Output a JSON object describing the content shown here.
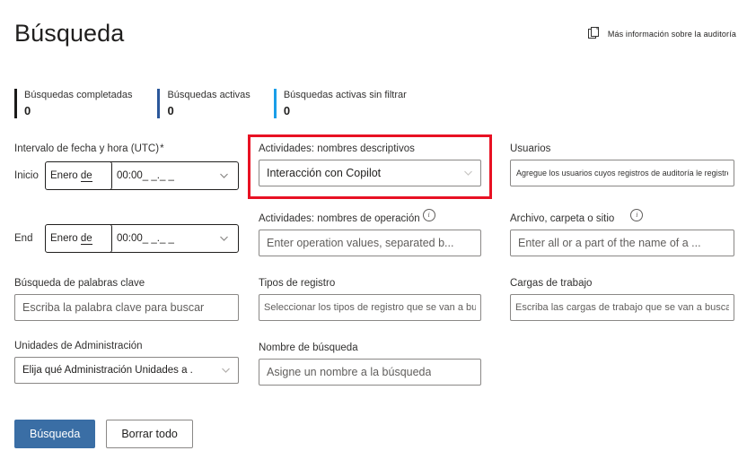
{
  "header": {
    "title": "Búsqueda",
    "help_link": "Más información sobre la auditoría",
    "help_icon": "documents-copy-icon"
  },
  "stats": [
    {
      "title": "Búsquedas completadas",
      "value": "0",
      "color": "#1b1a19"
    },
    {
      "title": "Búsquedas activas",
      "value": "0",
      "color": "#2b579a"
    },
    {
      "title": "Búsquedas activas sin filtrar",
      "value": "0",
      "color": "#1a9ee8"
    }
  ],
  "form": {
    "date_range": {
      "label": "Intervalo de fecha y hora (UTC)",
      "required_mark": "*",
      "start": {
        "row_label": "Inicio",
        "date_value_a": "Enero",
        "date_value_b": "de",
        "time_value": "00:00_ _._ _"
      },
      "end": {
        "row_label": "End",
        "date_value_a": "Enero",
        "date_value_b": "de",
        "time_value": "00:00_ _._ _"
      }
    },
    "keyword": {
      "label": "Búsqueda de palabras clave",
      "placeholder": "Escriba la palabra clave para buscar"
    },
    "admin_units": {
      "label": "Unidades de Administración",
      "value": "Elija qué Administración   Unidades a ."
    },
    "activities_friendly": {
      "label": "Actividades: nombres descriptivos",
      "value": "Interacción con Copilot"
    },
    "activities_operation": {
      "label": "Actividades: nombres de operación",
      "info_icon": "info-circle-icon",
      "placeholder": "Enter operation values, separated b..."
    },
    "record_types": {
      "label": "Tipos de registro",
      "placeholder": "Seleccionar los tipos de registro que se van a buscar"
    },
    "search_name": {
      "label": "Nombre de búsqueda",
      "placeholder": "Asigne un nombre a la búsqueda"
    },
    "users": {
      "label": "Usuarios",
      "placeholder": "Agregue los usuarios cuyos registros de auditoría le registren ."
    },
    "file_folder_site": {
      "label": "Archivo, carpeta o sitio",
      "info_icon": "info-circle-icon",
      "placeholder": "Enter all or a part of the name of a ..."
    },
    "workloads": {
      "label": "Cargas de trabajo",
      "placeholder": "Escriba las cargas de trabajo que se van a buscar"
    }
  },
  "footer": {
    "search_button": "Búsqueda",
    "clear_button": "Borrar todo"
  },
  "highlight": {
    "color": "#e81123",
    "target": "activities-friendly-names-field"
  }
}
